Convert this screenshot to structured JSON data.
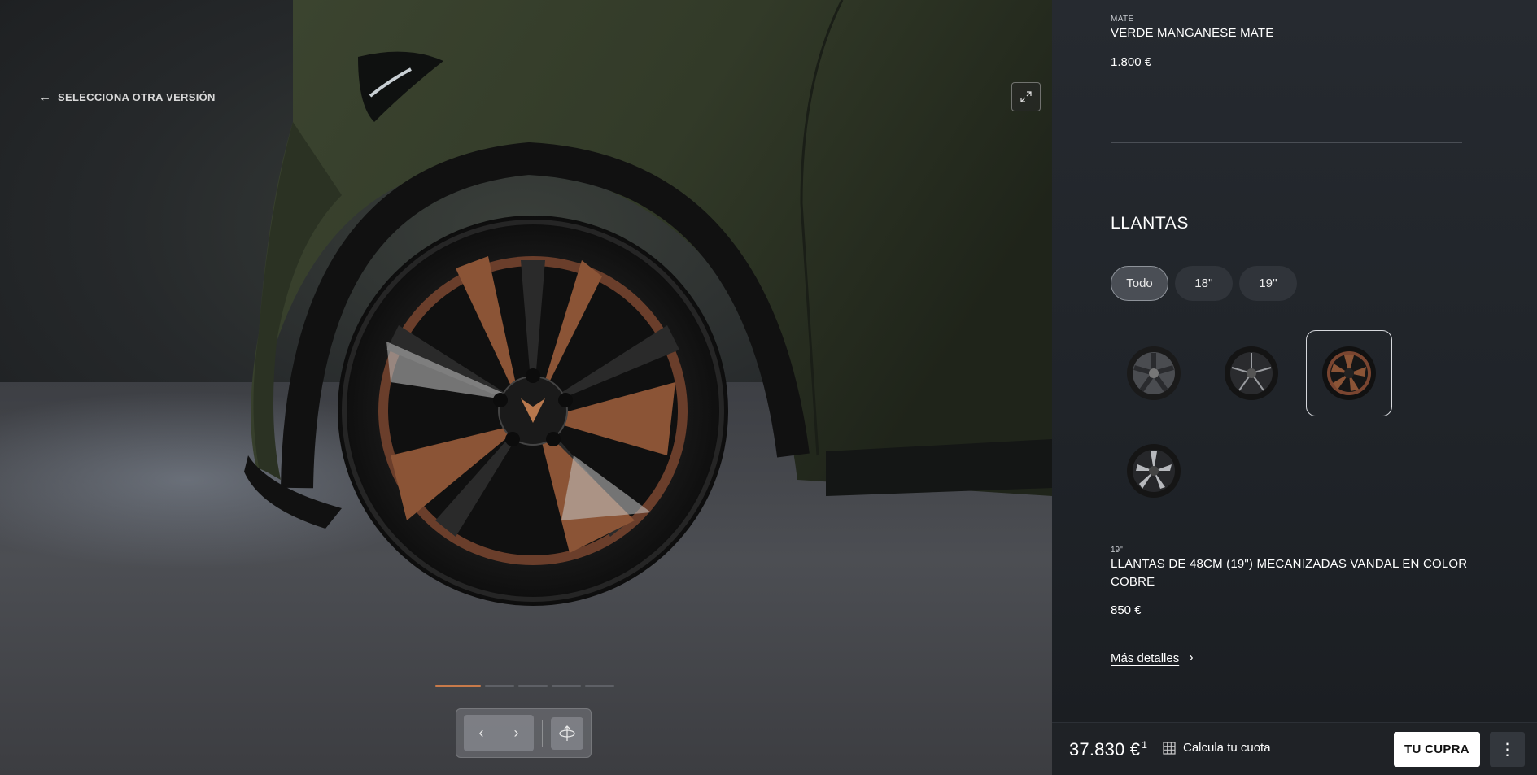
{
  "viewer": {
    "back_label": "SELECCIONA OTRA VERSIÓN",
    "expand_icon": "expand-icon",
    "gallery_slides": 5,
    "gallery_active_index": 0,
    "nav_prev_icon": "chevron-left-icon",
    "nav_next_icon": "chevron-right-icon",
    "view_360_icon": "rotate-360-icon"
  },
  "colors": {
    "copper": "#c87a4a",
    "body_green": "#3c4530"
  },
  "color_option": {
    "finish": "MATE",
    "name": "VERDE MANGANESE MATE",
    "price": "1.800 €"
  },
  "wheels_section": {
    "title": "LLANTAS",
    "filters": [
      {
        "label": "Todo",
        "active": true
      },
      {
        "label": "18''",
        "active": false
      },
      {
        "label": "19''",
        "active": false
      }
    ],
    "options": [
      {
        "name": "wheel-option-1",
        "selected": false
      },
      {
        "name": "wheel-option-2",
        "selected": false
      },
      {
        "name": "wheel-option-3",
        "selected": true
      },
      {
        "name": "wheel-option-4",
        "selected": false
      }
    ],
    "selected_size": "19''",
    "selected_name": "LLANTAS DE 48CM (19\") MECANIZADAS VANDAL EN COLOR COBRE",
    "selected_price": "850 €",
    "more_label": "Más detalles"
  },
  "footer": {
    "total_price": "37.830 €",
    "total_note": "1",
    "calc_label": "Calcula tu cuota",
    "cta_label": "TU CUPRA",
    "menu_icon": "kebab-menu-icon"
  }
}
